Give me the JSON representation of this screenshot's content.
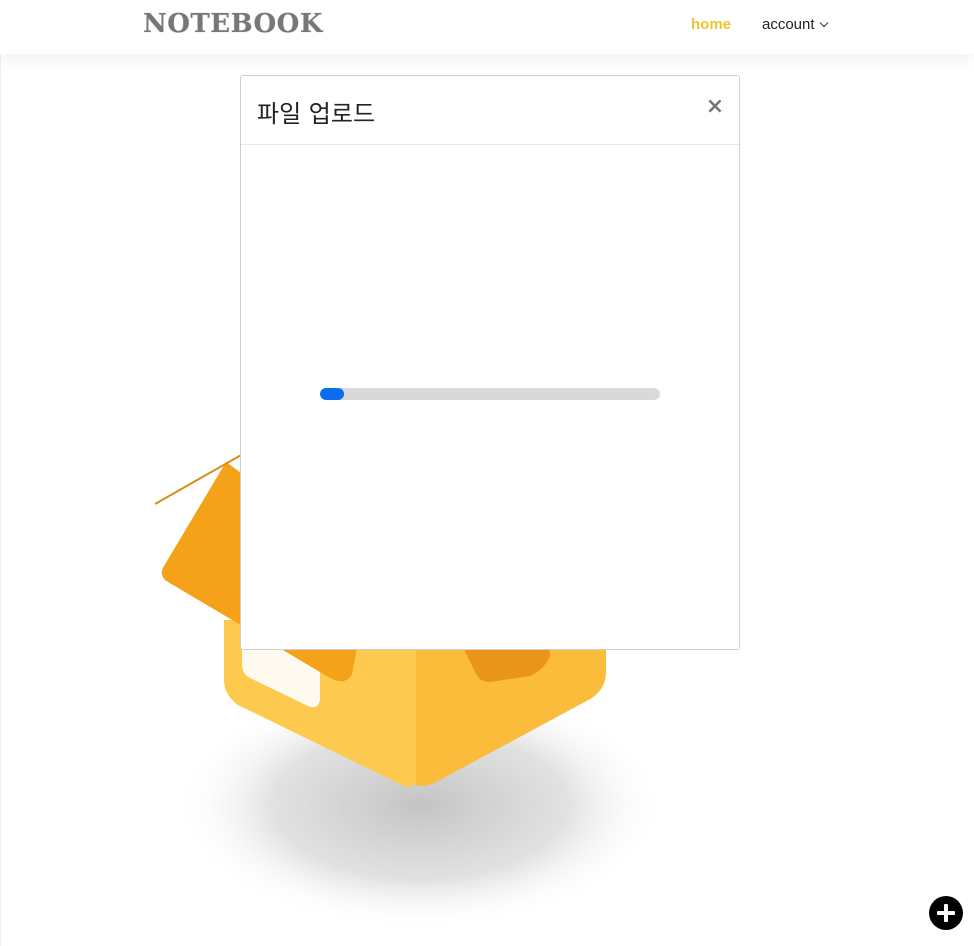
{
  "navbar": {
    "brand": "NOTEBOOK",
    "home_label": "home",
    "account_label": "account",
    "account_menu_icon": "chevron-down-icon",
    "active_color": "#f2c12e"
  },
  "modal": {
    "title": "파일 업로드",
    "close_label": "×",
    "close_icon": "close-icon",
    "progress": {
      "value_percent": 7,
      "fill_color": "#0a6cf0",
      "track_color": "#d9d9d9"
    }
  },
  "fab": {
    "icon": "plus-icon",
    "color": "#000000"
  },
  "illustration": {
    "icon": "open-box-illustration",
    "colors": {
      "flap": "#f5a21b",
      "box_left": "#fdc94e",
      "box_right": "#fbbd3c"
    }
  }
}
